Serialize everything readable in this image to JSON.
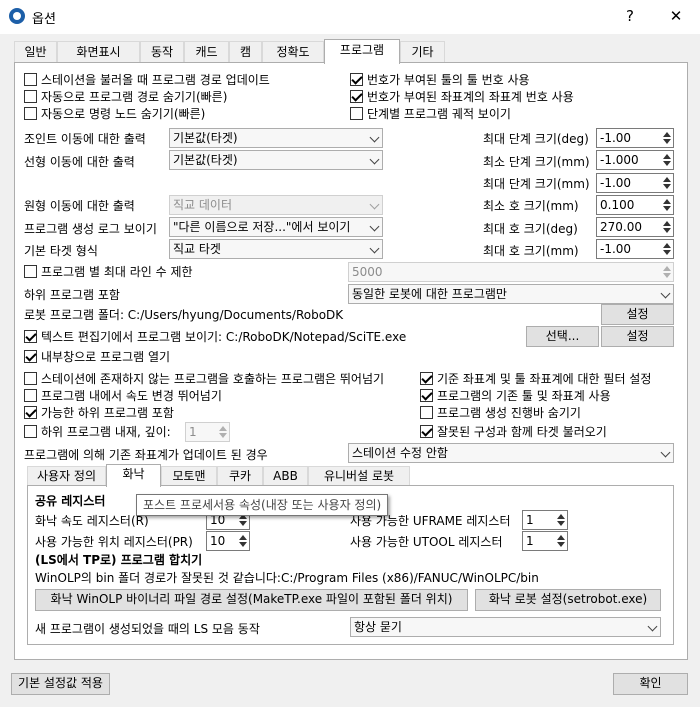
{
  "window": {
    "title": "옵션",
    "help_label": "?",
    "close_label": "✕"
  },
  "tabs": [
    "일반",
    "화면표시",
    "동작",
    "캐드",
    "캠",
    "정확도",
    "프로그램",
    "기타"
  ],
  "checkboxes": {
    "update_path_on_load": "스테이션을 불러올 때 프로그램 경로 업데이트",
    "auto_hide_path": "자동으로 프로그램 경로 숨기기(빠른)",
    "auto_hide_cmd": "자동으로 명령 노드 숨기기(빠른)",
    "tool_numbered": "번호가 부여된 툴의 툴 번호 사용",
    "frame_numbered": "번호가 부여된 좌표계의 좌표계 번호 사용",
    "step_trace": "단계별 프로그램 궤적 보이기"
  },
  "motion": {
    "joint_label": "조인트 이동에 대한 출력",
    "joint_value": "기본값(타겟)",
    "linear_label": "선형 이동에 대한 출력",
    "linear_value": "기본값(타겟)",
    "circular_label": "원형 이동에 대한 출력",
    "circular_value": "직교 데이터",
    "log_label": "프로그램 생성 로그 보이기",
    "log_value": "\"다른 이름으로 저장...\"에서 보이기",
    "target_label": "기본 타겟 형식",
    "target_value": "직교 타겟"
  },
  "steps": {
    "max_step_deg_label": "최대 단계 크기(deg)",
    "max_step_deg": "-1.00",
    "min_step_mm_label": "최소 단계 크기(mm)",
    "min_step_mm": "-1.000",
    "max_step_mm_label": "최대 단계 크기(mm)",
    "max_step_mm": "-1.00",
    "min_arc_mm_label": "최소 호 크기(mm)",
    "min_arc_mm": "0.100",
    "max_arc_deg_label": "최대 호 크기(deg)",
    "max_arc_deg": "270.00",
    "max_arc_mm_label": "최대 호 크기(mm)",
    "max_arc_mm": "-1.00"
  },
  "max_lines": {
    "label": "프로그램 별 최대 라인 수 제한",
    "value": "5000"
  },
  "subprogram": {
    "label": "하위 프로그램 포함",
    "value": "동일한 로봇에 대한 프로그램만"
  },
  "robot_folder": {
    "label": "로봇 프로그램 폴더: C:/Users/hyung/Documents/RoboDK",
    "button": "설정"
  },
  "text_editor": {
    "label": "텍스트 편집기에서 프로그램 보이기:  C:/RoboDK/Notepad/SciTE.exe",
    "select_button": "선택...",
    "setup_button": "설정"
  },
  "open_internal": "내부창으로 프로그램 열기",
  "options": {
    "skip_missing": "스테이션에 존재하지 않는 프로그램을 호출하는 프로그램은 뛰어넘기",
    "skip_speed": "프로그램 내에서 속도 변경 뛰어넘기",
    "include_possible": "가능한 하위 프로그램 포함",
    "embed_subprogram": "하위 프로그램 내재, 깊이:",
    "embed_depth": "1",
    "filter_frames": "기준 좌표계 및 툴 좌표계에 대한 필터 설정",
    "use_base_tool": "프로그램의 기존 툴 및 좌표계 사용",
    "hide_progress": "프로그램 생성 진행바 숨기기",
    "load_bad_config": "잘못된 구성과 함께 타겟 불러오기"
  },
  "frame_update": {
    "label": "프로그램에 의해 기존 좌표계가 업데이트 된 경우",
    "value": "스테이션 수정 안함"
  },
  "subtabs": [
    "사용자 정의",
    "화낙",
    "모토맨",
    "쿠카",
    "ABB",
    "유니버설 로봇"
  ],
  "fanuc": {
    "registers_title": "공유 레지스터",
    "speed_register_label": "화낙 속도 레지스터(R)",
    "speed_register": "10",
    "position_register_label": "사용 가능한 위치 레지스터(PR)",
    "position_register": "10",
    "uframe_label": "사용 가능한 UFRAME 레지스터",
    "uframe": "1",
    "utool_label": "사용 가능한 UTOOL 레지스터",
    "utool": "1",
    "ls_title": "(LS에서 TP로) 프로그램 합치기",
    "winolp_warning": "WinOLP의 bin 폴더 경로가 잘못된 것 같습니다:C:/Program Files (x86)/FANUC/WinOLPC/bin",
    "winolp_button": "화낙 WinOLP 바이너리 파일 경로 설정(MakeTP.exe 파일이 포함된 폴더 위치)",
    "setrobot_button": "화낙 로봇 설정(setrobot.exe)",
    "new_program_label": "새 프로그램이 생성되었을 때의 LS 모음 동작",
    "new_program_value": "항상 묻기"
  },
  "tooltip": "포스트 프로세서용 속성(내장 또는 사용자 정의)",
  "footer": {
    "defaults_button": "기본 설정값 적용",
    "ok_button": "확인"
  }
}
